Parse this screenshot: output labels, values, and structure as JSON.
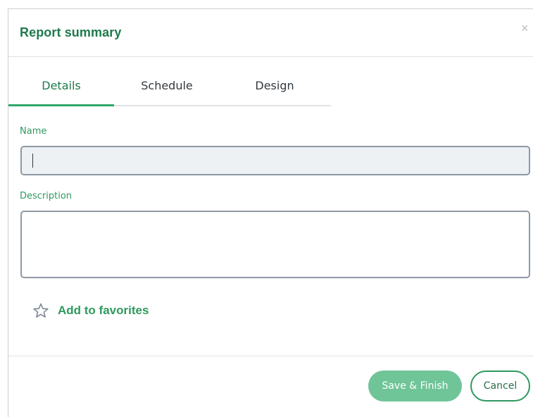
{
  "dialog": {
    "title": "Report summary",
    "close_icon": "close-icon",
    "close_glyph": "×"
  },
  "tabs": [
    {
      "label": "Details",
      "active": true
    },
    {
      "label": "Schedule",
      "active": false
    },
    {
      "label": "Design",
      "active": false
    }
  ],
  "form": {
    "name_label": "Name",
    "name_value": "",
    "description_label": "Description",
    "description_value": ""
  },
  "favorites": {
    "icon": "star-outline-icon",
    "label": "Add to favorites"
  },
  "footer": {
    "save_label": "Save & Finish",
    "cancel_label": "Cancel"
  },
  "colors": {
    "accent": "#2ea86a",
    "title": "#1e7a4c",
    "save_button": "#6fc598"
  }
}
